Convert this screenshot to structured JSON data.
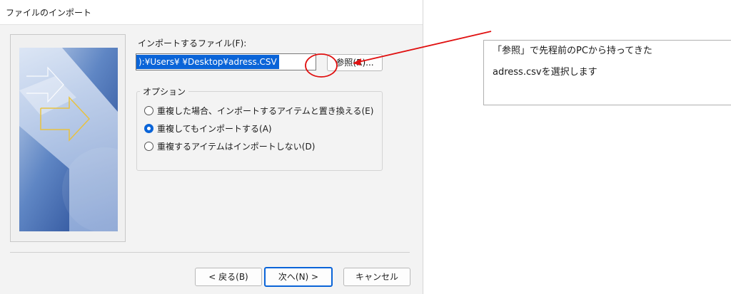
{
  "window": {
    "title": "ファイルのインポート"
  },
  "file": {
    "label": "インポートするファイル(F):",
    "path_value": "):¥Users¥     ¥Desktop¥adress.CSV",
    "browse_label": "参照(R)..."
  },
  "options": {
    "title": "オプション",
    "items": [
      {
        "label": "重複した場合、インポートするアイテムと置き換える(E)",
        "selected": false
      },
      {
        "label": "重複してもインポートする(A)",
        "selected": true
      },
      {
        "label": "重複するアイテムはインポートしない(D)",
        "selected": false
      }
    ]
  },
  "buttons": {
    "back_label": "< 戻る(B)",
    "next_label": "次へ(N) >",
    "cancel_label": "キャンセル"
  },
  "annotation": {
    "line1": "「参照」で先程前のPCから持ってきた",
    "line2": "adress.csvを選択します"
  },
  "colors": {
    "accent": "#0a64d8",
    "annotation_red": "#e01010"
  }
}
